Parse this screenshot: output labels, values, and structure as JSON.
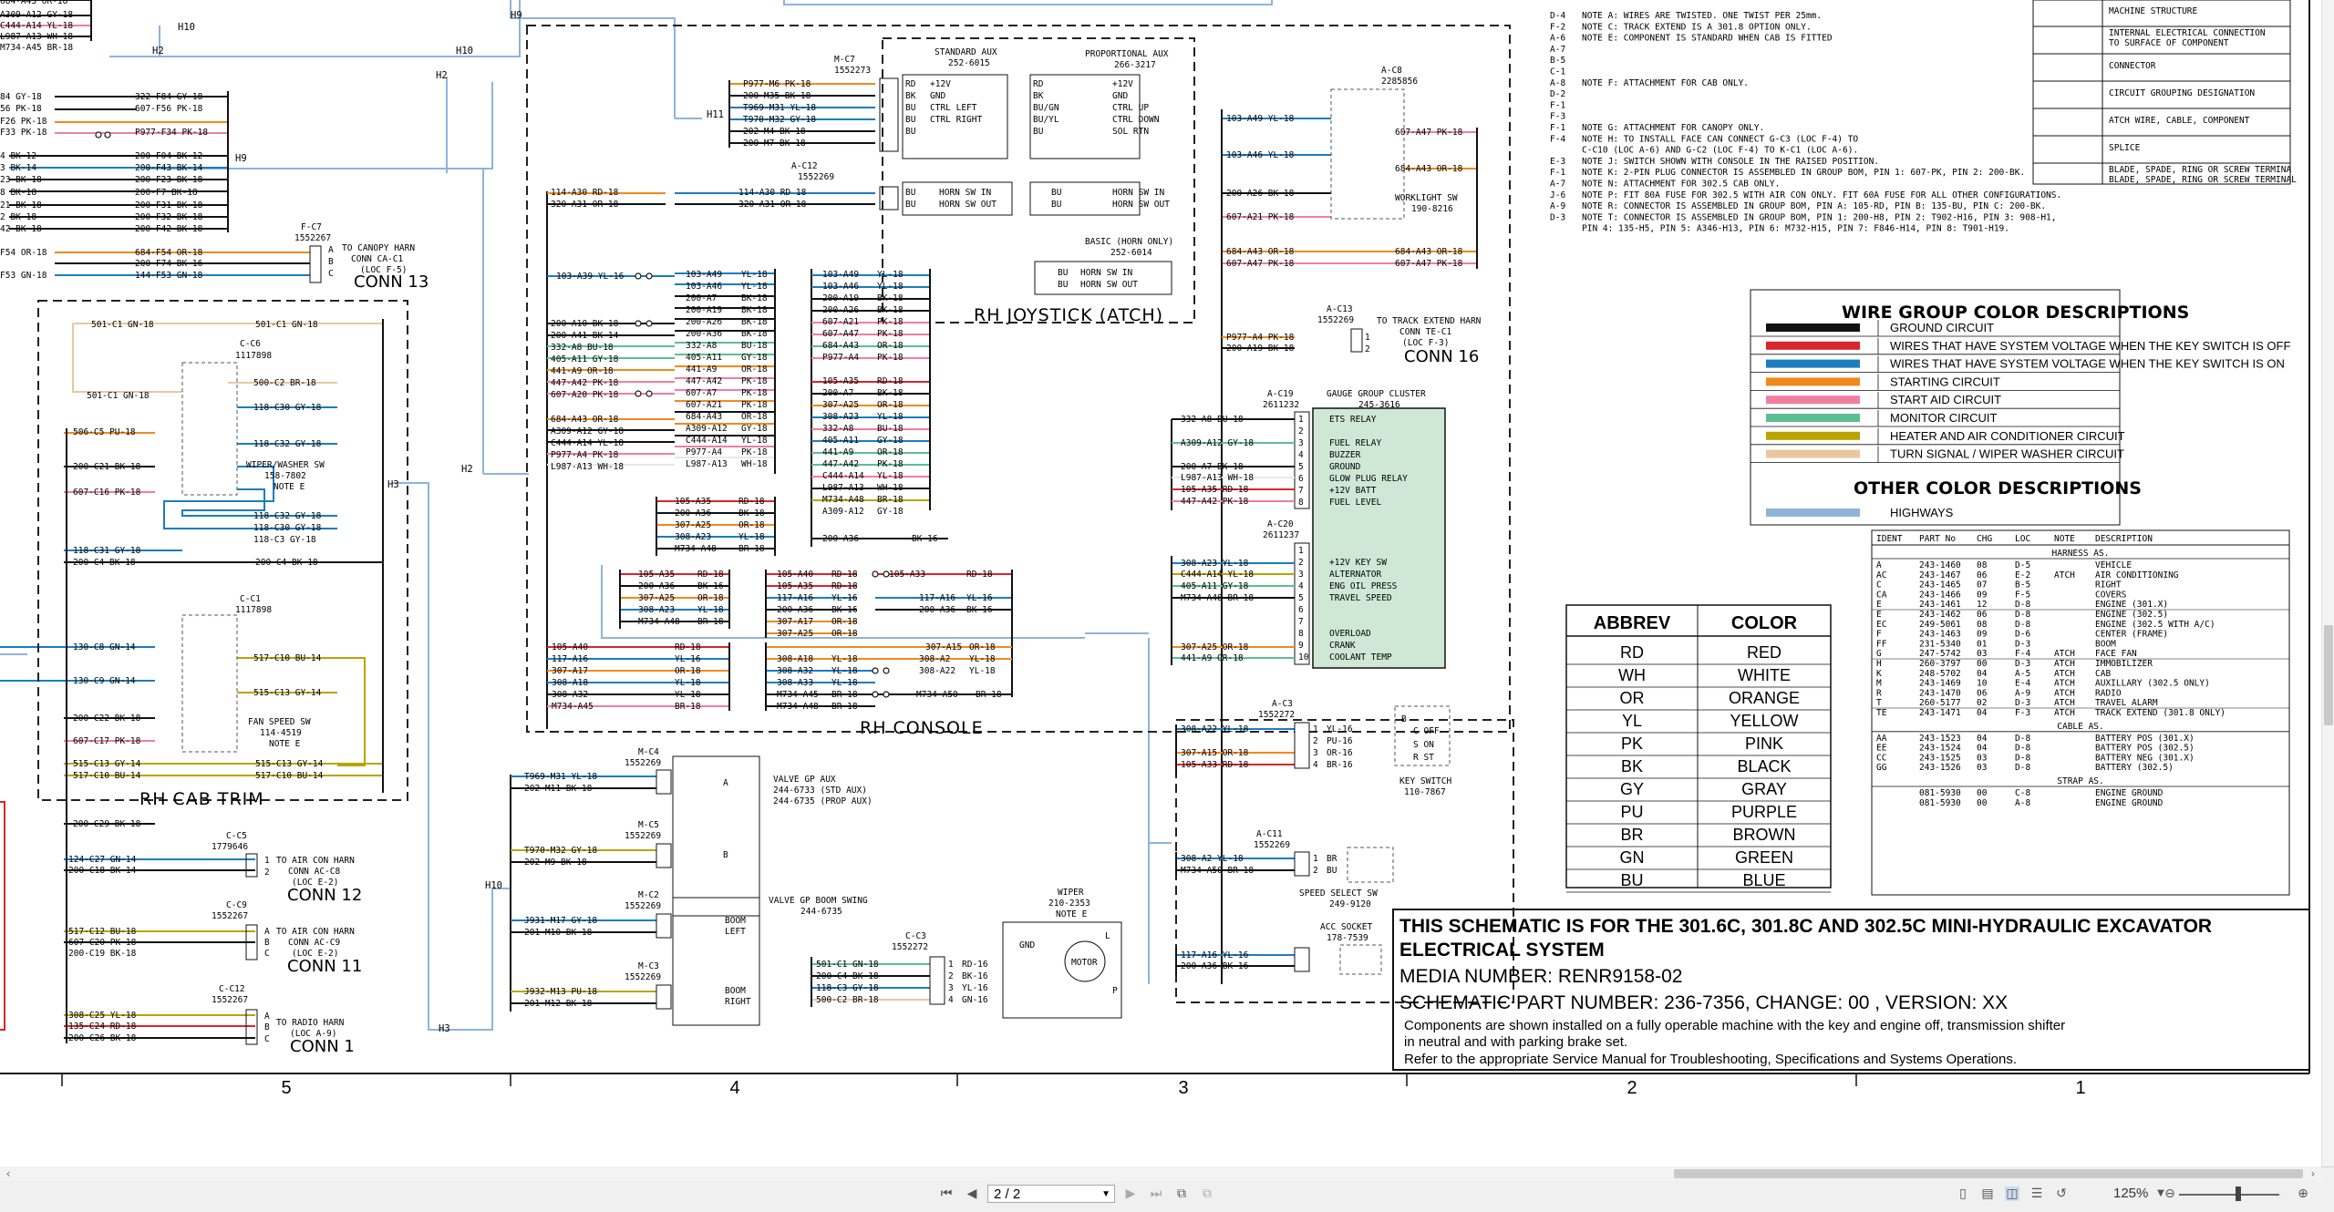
{
  "schematic": {
    "notes": [
      [
        "D-4",
        "NOTE A: WIRES ARE TWISTED.  ONE TWIST PER 25mm."
      ],
      [
        "F-2",
        "NOTE C: TRACK EXTEND IS A 301.8 OPTION ONLY."
      ],
      [
        "A-6",
        "NOTE E: COMPONENT IS STANDARD WHEN CAB IS FITTED"
      ],
      [
        "A-7",
        ""
      ],
      [
        "B-5",
        ""
      ],
      [
        "C-1",
        ""
      ],
      [
        "A-8",
        "NOTE F: ATTACHMENT FOR CAB ONLY."
      ],
      [
        "D-2",
        ""
      ],
      [
        "F-1",
        ""
      ],
      [
        "F-3",
        ""
      ],
      [
        "F-1",
        "NOTE G: ATTACHMENT FOR CANOPY ONLY."
      ],
      [
        "F-4",
        "NOTE H: TO INSTALL FACE CAN CONNECT G-C3 (LOC F-4) TO"
      ],
      [
        "",
        "        C-C10 (LOC A-6) AND G-C2 (LOC F-4) TO K-C1 (LOC A-6)."
      ],
      [
        "E-3",
        "NOTE J: SWITCH SHOWN WITH CONSOLE IN THE RAISED POSITION."
      ],
      [
        "F-1",
        "NOTE K: 2-PIN PLUG CONNECTOR IS ASSEMBLED IN GROUP BOM, PIN 1: 607-PK, PIN 2: 200-BK."
      ],
      [
        "A-7",
        "NOTE N: ATTACHMENT FOR 302.5 CAB ONLY."
      ],
      [
        "J-6",
        "NOTE P: FIT 80A FUSE FOR 302.5 WITH AIR CON ONLY. FIT 60A FUSE FOR ALL OTHER CONFIGURATIONS."
      ],
      [
        "A-9",
        "NOTE R: CONNECTOR IS ASSEMBLED IN GROUP BOM, PIN A: 105-RD, PIN B: 135-BU, PIN C: 200-BK."
      ],
      [
        "D-3",
        "NOTE T: CONNECTOR IS ASSEMBLED IN GROUP BOM, PIN 1: 200-H8, PIN 2: T902-H16, PIN 3: 908-H1,"
      ],
      [
        "",
        "        PIN 4: 135-H5, PIN 5: A346-H13, PIN 6: M732-H15, PIN 7: F846-H14, PIN 8: T901-H19."
      ]
    ],
    "symbols": [
      "MACHINE STRUCTURE",
      "INTERNAL ELECTRICAL CONNECTION TO SURFACE OF COMPONENT",
      "CONNECTOR",
      "CIRCUIT GROUPING DESIGNATION",
      "ATCH WIRE, CABLE, COMPONENT",
      "SPLICE",
      "BLADE, SPADE, RING OR SCREW TERMINAL"
    ],
    "wire_group_title": "WIRE GROUP COLOR DESCRIPTIONS",
    "wire_groups": [
      {
        "label": "GROUND CIRCUIT",
        "color": "#111111"
      },
      {
        "label": "WIRES THAT HAVE SYSTEM VOLTAGE WHEN THE KEY SWITCH IS OFF",
        "color": "#d7262d"
      },
      {
        "label": "WIRES THAT HAVE SYSTEM VOLTAGE WHEN THE KEY SWITCH IS ON",
        "color": "#1a7dbf"
      },
      {
        "label": "STARTING CIRCUIT",
        "color": "#f08a1e"
      },
      {
        "label": "START AID CIRCUIT",
        "color": "#f07ea0"
      },
      {
        "label": "MONITOR CIRCUIT",
        "color": "#5dbf91"
      },
      {
        "label": "HEATER AND AIR CONDITIONER CIRCUIT",
        "color": "#b9a400"
      },
      {
        "label": "TURN SIGNAL / WIPER WASHER CIRCUIT",
        "color": "#e8c8a2"
      }
    ],
    "other_title": "OTHER COLOR DESCRIPTIONS",
    "other_colors": [
      {
        "label": "HIGHWAYS",
        "color": "#8fb4d9"
      }
    ],
    "abbrev_header": [
      "ABBREV",
      "COLOR"
    ],
    "abbrev": [
      [
        "RD",
        "RED"
      ],
      [
        "WH",
        "WHITE"
      ],
      [
        "OR",
        "ORANGE"
      ],
      [
        "YL",
        "YELLOW"
      ],
      [
        "PK",
        "PINK"
      ],
      [
        "BK",
        "BLACK"
      ],
      [
        "GY",
        "GRAY"
      ],
      [
        "PU",
        "PURPLE"
      ],
      [
        "BR",
        "BROWN"
      ],
      [
        "GN",
        "GREEN"
      ],
      [
        "BU",
        "BLUE"
      ]
    ],
    "parts_header": [
      "IDENT",
      "PART No",
      "CHG",
      "LOC",
      "NOTE",
      "DESCRIPTION"
    ],
    "parts_sections": [
      {
        "title": "HARNESS AS.",
        "rows": [
          [
            "A",
            "243-1460",
            "08",
            "D-5",
            "",
            "VEHICLE"
          ],
          [
            "AC",
            "243-1467",
            "06",
            "E-2",
            "ATCH",
            "AIR CONDITIONING"
          ],
          [
            "C",
            "243-1465",
            "07",
            "B-5",
            "",
            "RIGHT"
          ],
          [
            "CA",
            "243-1466",
            "09",
            "F-5",
            "",
            "COVERS"
          ],
          [
            "E",
            "243-1461",
            "12",
            "D-8",
            "",
            "ENGINE (301.X)"
          ],
          [
            "E",
            "243-1462",
            "06",
            "D-8",
            "",
            "ENGINE (302.5)"
          ],
          [
            "EC",
            "249-5061",
            "08",
            "D-8",
            "",
            "ENGINE (302.5 WITH A/C)"
          ],
          [
            "F",
            "243-1463",
            "09",
            "D-6",
            "",
            "CENTER (FRAME)"
          ],
          [
            "FF",
            "231-5340",
            "01",
            "D-3",
            "",
            "BOOM"
          ],
          [
            "G",
            "247-5742",
            "03",
            "F-4",
            "ATCH",
            "FACE FAN"
          ],
          [
            "H",
            "260-3797",
            "00",
            "D-3",
            "ATCH",
            "IMMOBILIZER"
          ],
          [
            "K",
            "248-5702",
            "04",
            "A-5",
            "ATCH",
            "CAB"
          ],
          [
            "M",
            "243-1469",
            "10",
            "E-4",
            "ATCH",
            "AUXILLARY (302.5 ONLY)"
          ],
          [
            "R",
            "243-1470",
            "06",
            "A-9",
            "ATCH",
            "RADIO"
          ],
          [
            "T",
            "260-5177",
            "02",
            "D-3",
            "ATCH",
            "TRAVEL ALARM"
          ],
          [
            "TE",
            "243-1471",
            "04",
            "F-3",
            "ATCH",
            "TRACK EXTEND (301.8 ONLY)"
          ]
        ]
      },
      {
        "title": "CABLE AS.",
        "rows": [
          [
            "AA",
            "243-1523",
            "04",
            "D-8",
            "",
            "BATTERY POS (301.X)"
          ],
          [
            "EE",
            "243-1524",
            "04",
            "D-8",
            "",
            "BATTERY POS (302.5)"
          ],
          [
            "CC",
            "243-1525",
            "03",
            "D-8",
            "",
            "BATTERY NEG (301.X)"
          ],
          [
            "GG",
            "243-1526",
            "03",
            "D-8",
            "",
            "BATTERY (302.5)"
          ]
        ]
      },
      {
        "title": "STRAP AS.",
        "rows": [
          [
            "",
            "081-5930",
            "00",
            "C-8",
            "",
            "ENGINE GROUND"
          ],
          [
            "",
            "081-5930",
            "00",
            "A-8",
            "",
            "ENGINE GROUND"
          ]
        ]
      }
    ],
    "title_block": {
      "title": "THIS SCHEMATIC IS FOR THE  301.6C,  301.8C AND 302.5C MINI-HYDRAULIC EXCAVATOR",
      "subtitle": "ELECTRICAL SYSTEM",
      "media": "MEDIA NUMBER: RENR9158-02",
      "part": "SCHEMATIC PART NUMBER: 236-7356, CHANGE: 00 , VERSION: XX",
      "body1": "Components are shown installed on a fully operable machine with the key and engine off, transmission shifter",
      "body2": "in neutral and with parking brake set.",
      "body3": "Refer to the appropriate Service Manual for Troubleshooting, Specifications and Systems Operations."
    },
    "grid_numbers": [
      "5",
      "4",
      "3",
      "2",
      "1"
    ],
    "groups": {
      "rh_console": "RH CONSOLE",
      "rh_joystick": "RH JOYSTICK (ATCH)",
      "rh_cab_trim": "RH CAB TRIM"
    },
    "components": {
      "std_aux": [
        "STANDARD AUX",
        "252-6015"
      ],
      "prop_aux": [
        "PROPORTIONAL AUX",
        "266-3217"
      ],
      "basic_horn": [
        "BASIC (HORN ONLY)",
        "252-6014"
      ],
      "a_c8": [
        "A-C8",
        "2285856"
      ],
      "worklight": [
        "WORKLIGHT SW",
        "190-8216"
      ],
      "a_c13": [
        "A-C13",
        "1552269"
      ],
      "track_ext": [
        "TO TRACK EXTEND HARN",
        "CONN TE-C1",
        "(LOC F-3)",
        "CONN 16"
      ],
      "a_c19": [
        "A-C19",
        "2611232"
      ],
      "gauge": [
        "GAUGE GROUP CLUSTER",
        "245-3616"
      ],
      "gauge_pins1": [
        "ETS RELAY",
        "",
        "FUEL RELAY",
        "BUZZER",
        "GROUND",
        "GLOW PLUG RELAY",
        "+12V BATT",
        "FUEL LEVEL"
      ],
      "a_c20": [
        "A-C20",
        "2611237"
      ],
      "gauge_pins2": [
        "",
        "+12V KEY SW",
        "ALTERNATOR",
        "ENG OIL PRESS",
        "TRAVEL SPEED",
        "",
        "",
        "OVERLOAD",
        "CRANK",
        "COOLANT TEMP"
      ],
      "a_c3": [
        "A-C3",
        "1552272"
      ],
      "key_switch": [
        "KEY SWITCH",
        "110-7867"
      ],
      "a_c11": [
        "A-C11",
        "1552269"
      ],
      "speed_sw": [
        "SPEED SELECT SW",
        "249-9120"
      ],
      "acc_socket": [
        "ACC SOCKET",
        "178-7539"
      ],
      "wiper": [
        "WIPER",
        "210-2353",
        "NOTE E"
      ],
      "c_c3": [
        "C-C3",
        "1552272"
      ],
      "valve_aux": [
        "VALVE GP AUX",
        "244-6733 (STD AUX)",
        "244-6735 (PROP AUX)"
      ],
      "valve_boom": [
        "VALVE GP BOOM SWING",
        "244-6735"
      ],
      "m_c4": [
        "M-C4",
        "1552269"
      ],
      "m_c5": [
        "M-C5",
        "1552269"
      ],
      "m_c2": [
        "M-C2",
        "1552269"
      ],
      "m_c3": [
        "M-C3",
        "1552269"
      ],
      "m_c7": [
        "M-C7",
        "1552273"
      ],
      "a_c12": [
        "A-C12",
        "1552269"
      ],
      "f_c7": [
        "F-C7",
        "1552267"
      ],
      "canopy": [
        "TO CANOPY HARN",
        "CONN CA-C1",
        "(LOC F-5)",
        "CONN 13"
      ],
      "c_c6": [
        "C-C6",
        "1117898"
      ],
      "wiper_sw": [
        "WIPER/WASHER SW",
        "158-7802",
        "NOTE E"
      ],
      "c_c1": [
        "C-C1",
        "1117898"
      ],
      "fan_sw": [
        "FAN SPEED SW",
        "114-4519",
        "NOTE E"
      ],
      "c_c5": [
        "C-C5",
        "1779646"
      ],
      "aircon12": [
        "TO AIR CON HARN",
        "CONN AC-C8",
        "(LOC E-2)",
        "CONN 12"
      ],
      "c_c9": [
        "C-C9",
        "1552267"
      ],
      "aircon11": [
        "TO AIR CON HARN",
        "CONN AC-C9",
        "(LOC E-2)",
        "CONN 11"
      ],
      "c_c12": [
        "C-C12",
        "1552267"
      ],
      "radio": [
        "TO RADIO HARN",
        "(LOC A-9)",
        "CONN 1"
      ]
    }
  },
  "toolbar": {
    "page_value": "2 / 2",
    "zoom": "125%"
  }
}
